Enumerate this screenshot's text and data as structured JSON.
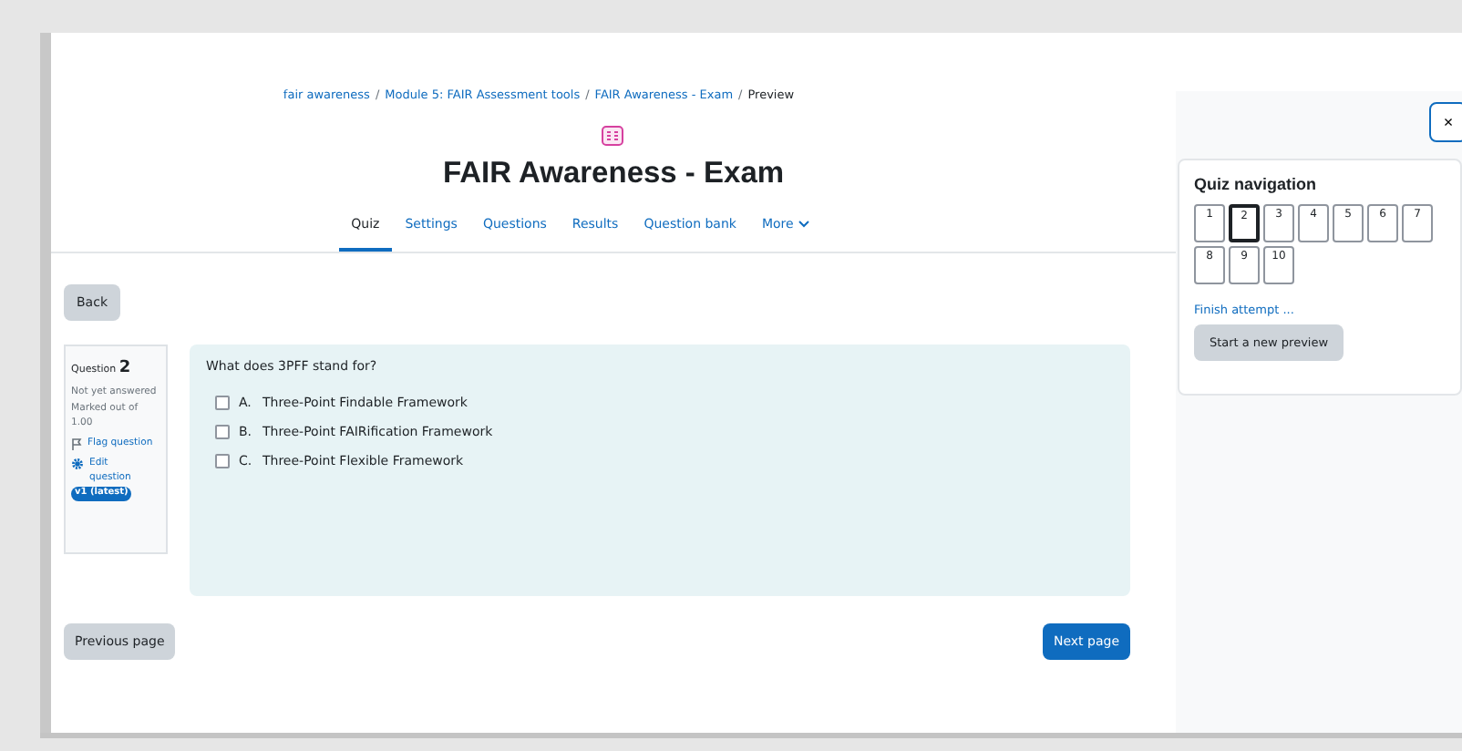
{
  "breadcrumb": [
    {
      "kind": "crumb",
      "text": "fair awareness",
      "link": true
    },
    {
      "kind": "separator",
      "text": "/"
    },
    {
      "kind": "crumb",
      "text": "Module 5: FAIR Assessment tools",
      "link": true
    },
    {
      "kind": "separator",
      "text": "/"
    },
    {
      "kind": "crumb",
      "text": "FAIR Awareness - Exam",
      "link": true
    },
    {
      "kind": "separator",
      "text": "/"
    },
    {
      "kind": "crumb",
      "text": "Preview",
      "link": false
    }
  ],
  "title": "FAIR Awareness - Exam",
  "tabs": [
    {
      "label": "Quiz",
      "selected": true
    },
    {
      "label": "Settings",
      "selected": false
    },
    {
      "label": "Questions",
      "selected": false
    },
    {
      "label": "Results",
      "selected": false
    },
    {
      "label": "Question bank",
      "selected": false
    },
    {
      "label": "More",
      "selected": false,
      "dropdown": true
    }
  ],
  "back_button": "Back",
  "question_info": {
    "label": "Question",
    "number": "2",
    "status": "Not yet answered",
    "marks": "Marked out of 1.00",
    "flag": "Flag question",
    "edit": "Edit question",
    "version": "v1 (latest)"
  },
  "question": {
    "text": "What does 3PFF stand for?",
    "options": [
      {
        "letter": "A.",
        "text": "Three-Point Findable Framework",
        "checked": false
      },
      {
        "letter": "B.",
        "text": "Three-Point FAIRification Framework",
        "checked": false
      },
      {
        "letter": "C.",
        "text": "Three-Point Flexible Framework",
        "checked": false
      }
    ]
  },
  "previous_button": "Previous page",
  "next_button": "Next page",
  "drawer": {
    "close": "×",
    "title": "Quiz navigation",
    "questions": [
      {
        "label": "1",
        "selected": false
      },
      {
        "label": "2",
        "selected": true
      },
      {
        "label": "3",
        "selected": false
      },
      {
        "label": "4",
        "selected": false
      },
      {
        "label": "5",
        "selected": false
      },
      {
        "label": "6",
        "selected": false
      },
      {
        "label": "7",
        "selected": false
      },
      {
        "label": "8",
        "selected": false
      },
      {
        "label": "9",
        "selected": false
      },
      {
        "label": "10",
        "selected": false
      }
    ],
    "finish": "Finish attempt ...",
    "new_preview": "Start a new preview"
  }
}
